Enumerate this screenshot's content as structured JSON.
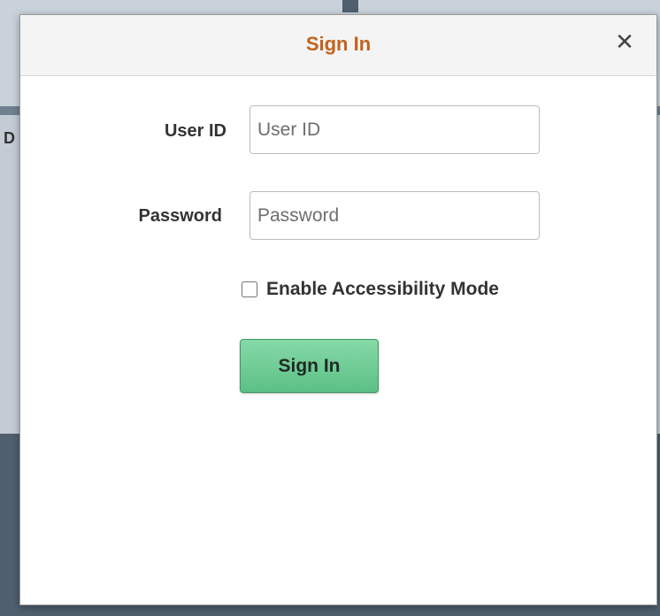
{
  "dialog": {
    "title": "Sign In",
    "close_glyph": "✕",
    "close_icon": "close-icon"
  },
  "form": {
    "user_id": {
      "label": "User ID",
      "placeholder": "User ID",
      "value": ""
    },
    "password": {
      "label": "Password",
      "placeholder": "Password",
      "value": ""
    },
    "accessibility": {
      "label": "Enable Accessibility Mode",
      "checked": false
    },
    "submit_label": "Sign In"
  },
  "background": {
    "partial_text": "D"
  },
  "colors": {
    "title": "#c2621d",
    "button": "#6ccb93",
    "backdrop_dark": "#4f5f6d"
  }
}
